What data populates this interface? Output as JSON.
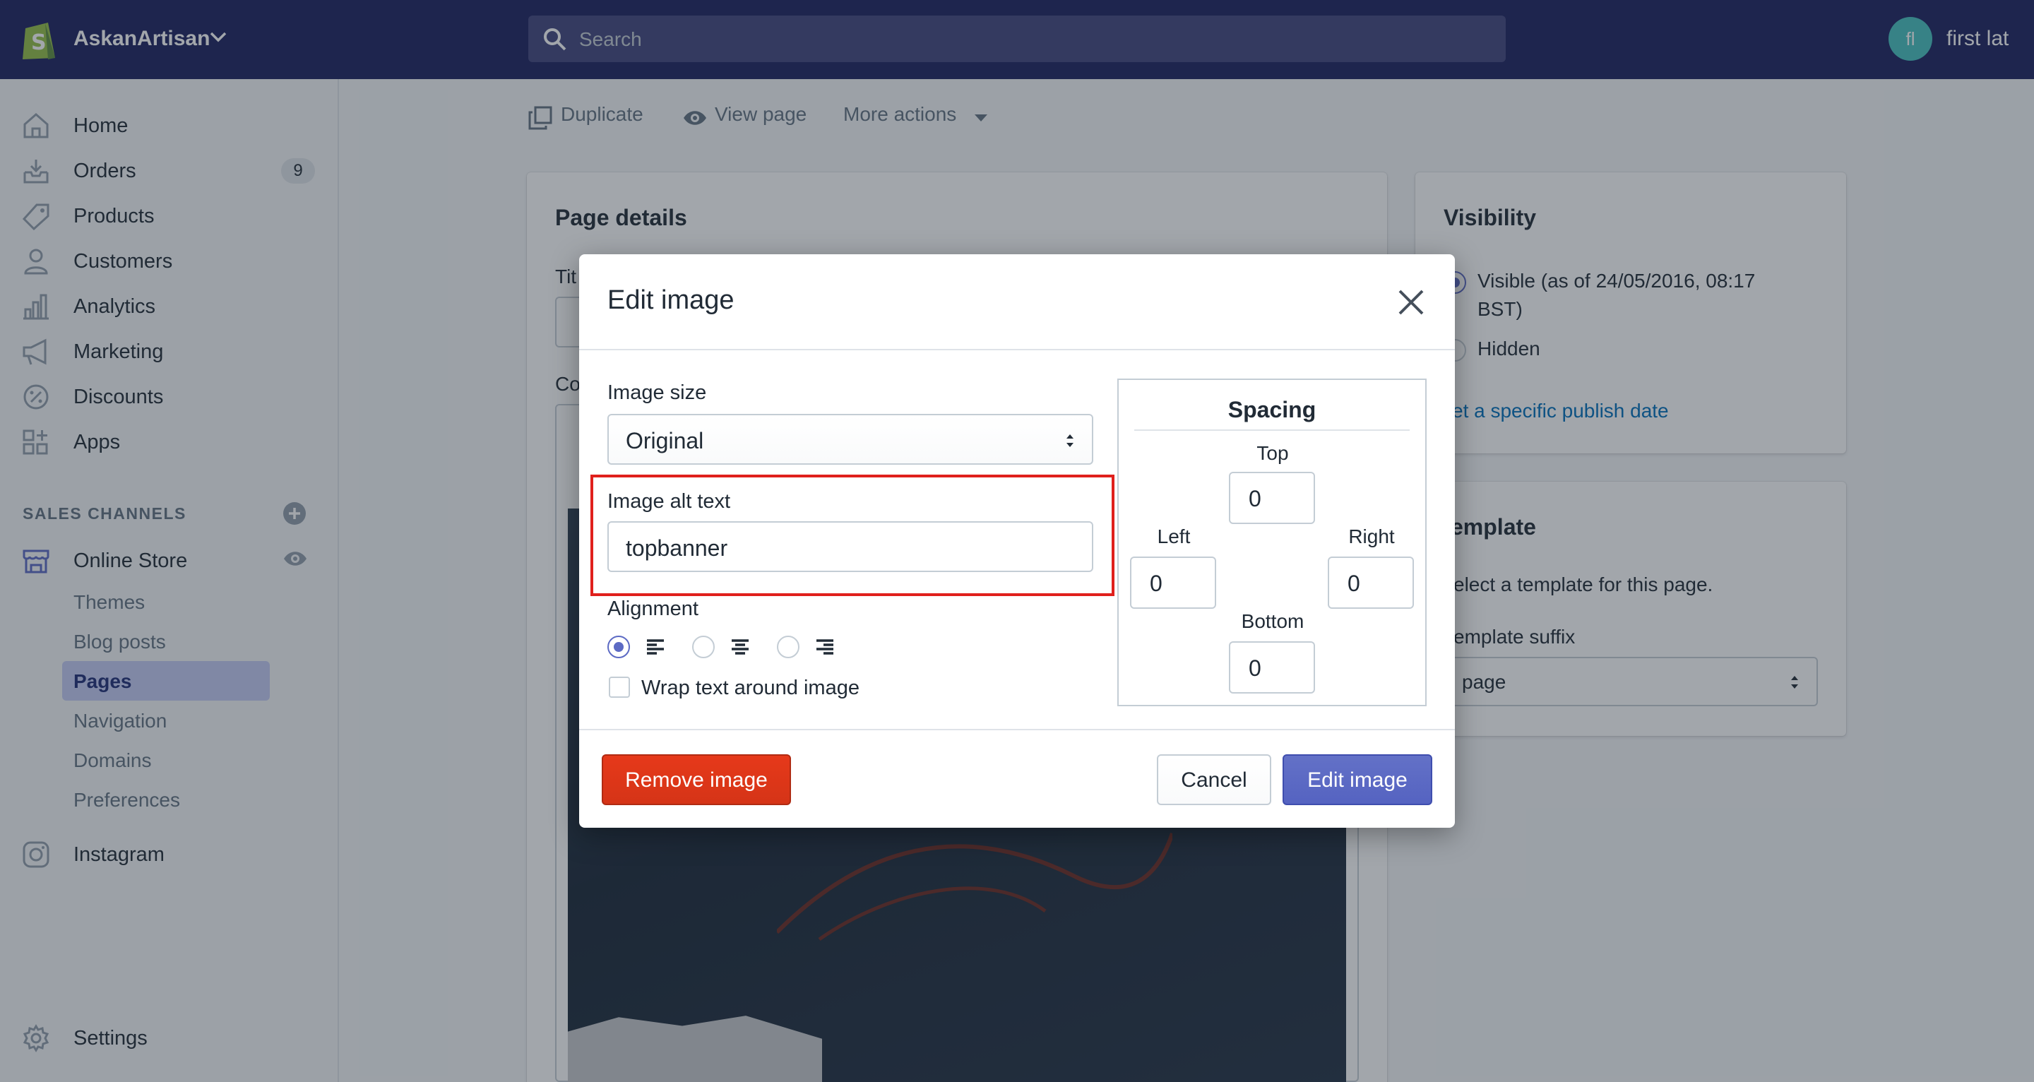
{
  "topbar": {
    "store_name": "AskanArtisan",
    "search_placeholder": "Search",
    "avatar_initials": "fl",
    "user_name": "first lat"
  },
  "sidebar": {
    "items": [
      {
        "label": "Home",
        "icon": "home-icon"
      },
      {
        "label": "Orders",
        "icon": "orders-icon",
        "badge": "9"
      },
      {
        "label": "Products",
        "icon": "tag-icon"
      },
      {
        "label": "Customers",
        "icon": "person-icon"
      },
      {
        "label": "Analytics",
        "icon": "bar-chart-icon"
      },
      {
        "label": "Marketing",
        "icon": "megaphone-icon"
      },
      {
        "label": "Discounts",
        "icon": "discount-icon"
      },
      {
        "label": "Apps",
        "icon": "apps-icon"
      }
    ],
    "sales_channels_title": "SALES CHANNELS",
    "online_store": "Online Store",
    "sub_items": [
      "Themes",
      "Blog posts",
      "Pages",
      "Navigation",
      "Domains",
      "Preferences"
    ],
    "active_sub_item": "Pages",
    "instagram": "Instagram",
    "settings": "Settings"
  },
  "page_actions": {
    "duplicate": "Duplicate",
    "view_page": "View page",
    "more_actions": "More actions"
  },
  "page_details": {
    "title": "Page details",
    "title_label_partial": "Tit",
    "content_label_partial": "Co"
  },
  "visibility": {
    "title": "Visibility",
    "visible_line1": "Visible (as of 24/05/2016, 08:17",
    "visible_line2": "BST)",
    "hidden": "Hidden",
    "publish_link": "et a specific publish date"
  },
  "template": {
    "title": "emplate",
    "description": "elect a template for this page.",
    "suffix_label": "emplate suffix",
    "suffix_value": "page"
  },
  "modal": {
    "title": "Edit image",
    "image_size_label": "Image size",
    "image_size_value": "Original",
    "alt_text_label": "Image alt text",
    "alt_text_value": "topbanner",
    "alignment_label": "Alignment",
    "alignment_selected": "left",
    "wrap_label": "Wrap text around image",
    "wrap_checked": false,
    "spacing": {
      "title": "Spacing",
      "top_label": "Top",
      "top": "0",
      "left_label": "Left",
      "left": "0",
      "right_label": "Right",
      "right": "0",
      "bottom_label": "Bottom",
      "bottom": "0"
    },
    "remove_button": "Remove image",
    "cancel_button": "Cancel",
    "submit_button": "Edit image"
  },
  "colors": {
    "topbar": "#1c2260",
    "primary": "#5c6ac4",
    "destructive": "#d53417",
    "highlight": "#e0201c"
  }
}
